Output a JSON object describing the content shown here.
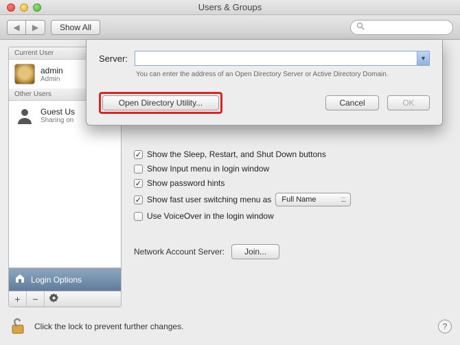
{
  "window": {
    "title": "Users & Groups"
  },
  "toolbar": {
    "show_all": "Show All",
    "search_placeholder": ""
  },
  "sidebar": {
    "sections": {
      "current": "Current User",
      "other": "Other Users"
    },
    "current_user": {
      "name": "admin",
      "role": "Admin"
    },
    "guest": {
      "name": "Guest Us",
      "sub": "Sharing on"
    },
    "login_options": "Login Options",
    "footer": {
      "plus": "+",
      "minus": "−",
      "gear": "✻"
    }
  },
  "options": {
    "show_buttons": "Show the Sleep, Restart, and Shut Down buttons",
    "input_menu": "Show Input menu in login window",
    "password_hints": "Show password hints",
    "fast_switch": "Show fast user switching menu as",
    "fast_switch_value": "Full Name",
    "voiceover": "Use VoiceOver in the login window",
    "states": {
      "show_buttons": true,
      "input_menu": false,
      "password_hints": true,
      "fast_switch": true,
      "voiceover": false
    }
  },
  "network_server": {
    "label": "Network Account Server:",
    "join": "Join..."
  },
  "footer": {
    "lock_text": "Click the lock to prevent further changes."
  },
  "sheet": {
    "server_label": "Server:",
    "hint": "You can enter the address of an Open Directory Server or Active Directory Domain.",
    "open_directory": "Open Directory Utility...",
    "cancel": "Cancel",
    "ok": "OK",
    "server_value": ""
  }
}
